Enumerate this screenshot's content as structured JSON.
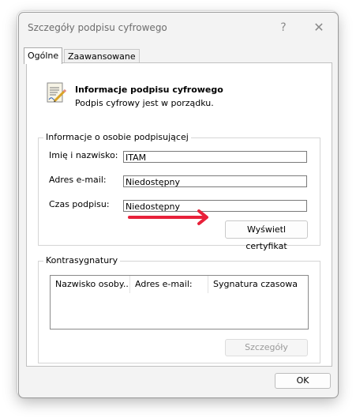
{
  "window": {
    "title": "Szczegóły podpisu cyfrowego",
    "help_glyph": "?",
    "close_glyph": "✕"
  },
  "tabs": [
    {
      "label": "Ogólne",
      "active": true
    },
    {
      "label": "Zaawansowane",
      "active": false
    }
  ],
  "info": {
    "icon": "signed-document-icon",
    "title": "Informacje podpisu cyfrowego",
    "status": "Podpis cyfrowy jest w porządku."
  },
  "signer": {
    "group_title": "Informacje o osobie podpisującej",
    "name_label": "Imię i nazwisko:",
    "name_value": "ITAM",
    "email_label": "Adres e-mail:",
    "email_value": "Niedostępny",
    "time_label": "Czas podpisu:",
    "time_value": "Niedostępny",
    "view_cert_label": "Wyświetl certyfikat"
  },
  "annotation": {
    "arrow_color": "#e8213a"
  },
  "countersignatures": {
    "group_title": "Kontrasygnatury",
    "columns": [
      "Nazwisko osoby...",
      "Adres e-mail:",
      "Sygnatura czasowa"
    ],
    "rows": [],
    "details_label": "Szczegóły"
  },
  "footer": {
    "ok_label": "OK"
  }
}
